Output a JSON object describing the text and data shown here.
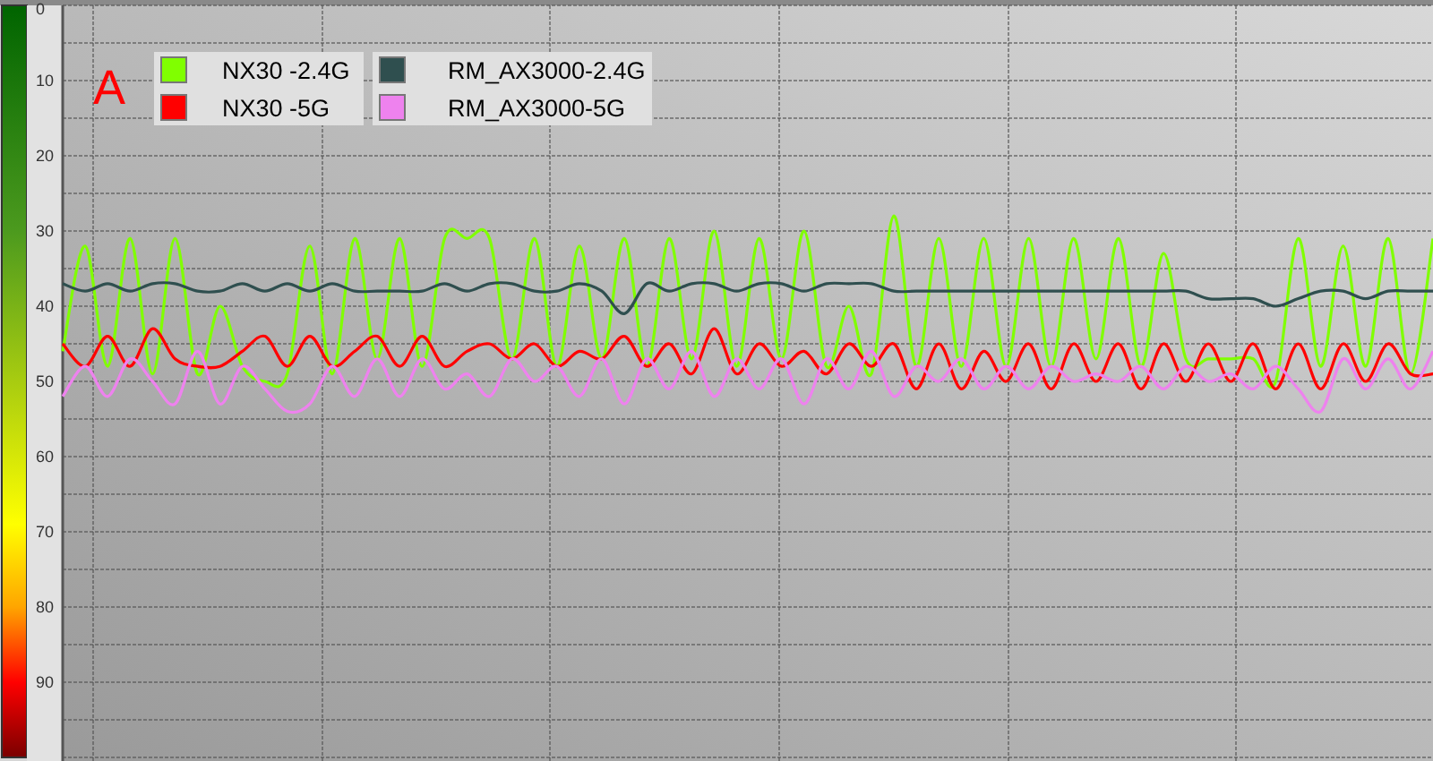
{
  "chart_data": {
    "type": "line",
    "ylim": [
      100,
      0
    ],
    "grid": true,
    "legend": true,
    "yticks": [
      0,
      10,
      20,
      30,
      40,
      50,
      60,
      70,
      80,
      90
    ],
    "annotations": [
      {
        "text": "A"
      }
    ],
    "series": [
      {
        "name": "NX30 -2.4G",
        "color": "#80ff00",
        "values": [
          46,
          32,
          48,
          31,
          49,
          31,
          49,
          40,
          48,
          50,
          49,
          32,
          49,
          31,
          47,
          31,
          48,
          31,
          31,
          31,
          47,
          31,
          48,
          32,
          47,
          31,
          48,
          31,
          47,
          30,
          48,
          31,
          47,
          30,
          48,
          40,
          49,
          28,
          48,
          31,
          48,
          31,
          48,
          31,
          48,
          31,
          47,
          31,
          48,
          33,
          47,
          47,
          47,
          47,
          50,
          31,
          48,
          32,
          48,
          31,
          49,
          31
        ]
      },
      {
        "name": "NX30 -5G",
        "color": "#ff0000",
        "values": [
          45,
          48,
          44,
          48,
          43,
          47,
          48,
          48,
          46,
          44,
          48,
          44,
          48,
          46,
          44,
          48,
          44,
          48,
          46,
          45,
          47,
          45,
          48,
          46,
          47,
          44,
          48,
          45,
          49,
          43,
          49,
          45,
          48,
          46,
          49,
          45,
          48,
          45,
          51,
          45,
          51,
          46,
          50,
          45,
          51,
          45,
          50,
          45,
          51,
          45,
          50,
          45,
          50,
          45,
          51,
          45,
          51,
          45,
          50,
          45,
          49,
          49
        ]
      },
      {
        "name": "RM_AX3000-2.4G",
        "color": "#2f4f4f",
        "values": [
          37,
          38,
          37,
          38,
          37,
          37,
          38,
          38,
          37,
          38,
          37,
          38,
          37,
          38,
          38,
          38,
          38,
          37,
          38,
          37,
          37,
          38,
          38,
          37,
          38,
          41,
          37,
          38,
          37,
          37,
          38,
          37,
          37,
          38,
          37,
          37,
          37,
          38,
          38,
          38,
          38,
          38,
          38,
          38,
          38,
          38,
          38,
          38,
          38,
          38,
          38,
          39,
          39,
          39,
          40,
          39,
          38,
          38,
          39,
          38,
          38,
          38
        ]
      },
      {
        "name": "RM_AX3000-5G",
        "color": "#ee82ee",
        "values": [
          52,
          48,
          52,
          47,
          50,
          53,
          46,
          53,
          48,
          51,
          54,
          53,
          48,
          52,
          47,
          52,
          47,
          51,
          49,
          52,
          47,
          50,
          48,
          52,
          47,
          53,
          47,
          51,
          46,
          52,
          47,
          51,
          47,
          53,
          47,
          51,
          46,
          52,
          48,
          50,
          47,
          51,
          48,
          51,
          48,
          50,
          49,
          50,
          48,
          51,
          48,
          50,
          49,
          51,
          48,
          51,
          54,
          47,
          51,
          47,
          51,
          46
        ]
      }
    ]
  }
}
